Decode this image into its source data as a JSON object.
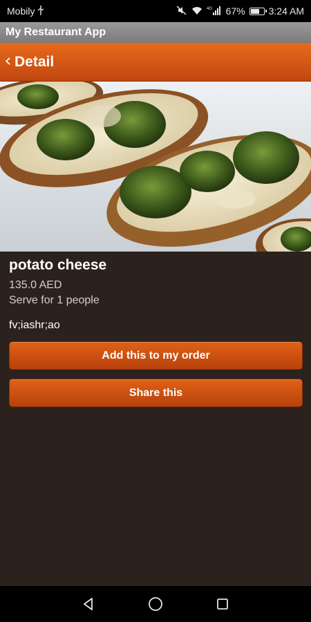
{
  "status_bar": {
    "carrier": "Mobily",
    "network_type": "4G",
    "battery_percent": "67%",
    "time": "3:24 AM"
  },
  "app": {
    "title": "My Restaurant App"
  },
  "header": {
    "back_icon": "chevron-left-icon",
    "title": "Detail"
  },
  "item": {
    "name": "potato cheese",
    "price": "135.0 AED",
    "serve": "Serve for 1 people",
    "description": "fv;iashr;ao"
  },
  "actions": {
    "add_order_label": "Add this to my order",
    "share_label": "Share this"
  },
  "nav_bar": {
    "icons": [
      "back-triangle-icon",
      "home-circle-icon",
      "recents-square-icon"
    ]
  }
}
